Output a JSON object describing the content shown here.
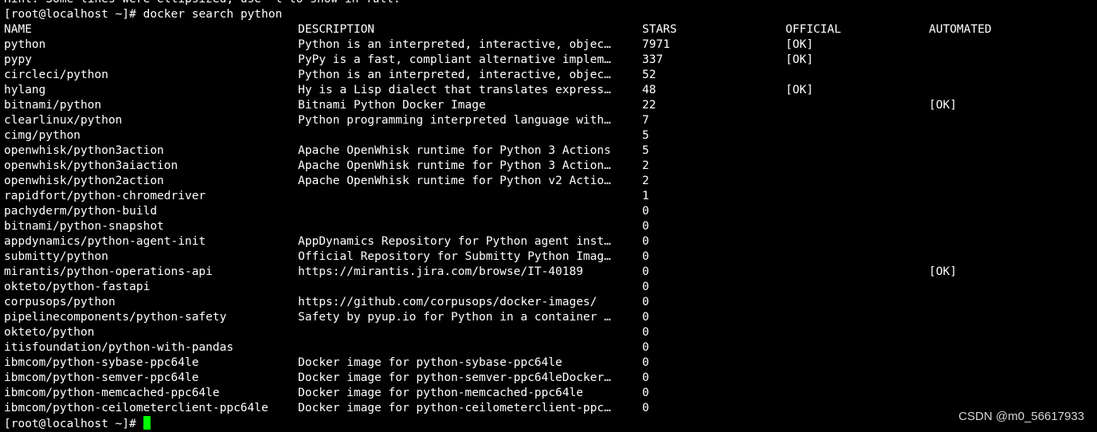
{
  "terminal": {
    "hint_text": "Hint: Some lines were ellipsized, use -l to show in full.",
    "command_prompt": "[root@localhost ~]# ",
    "command": "docker search python",
    "final_prompt": "[root@localhost ~]# ",
    "cursor_color": "#00ff00",
    "headers": {
      "name": "NAME",
      "description": "DESCRIPTION",
      "stars": "STARS",
      "official": "OFFICIAL",
      "automated": "AUTOMATED"
    },
    "rows": [
      {
        "name": "python",
        "description": "Python is an interpreted, interactive, objec…",
        "stars": "7971",
        "official": "[OK]",
        "automated": ""
      },
      {
        "name": "pypy",
        "description": "PyPy is a fast, compliant alternative implem…",
        "stars": "337",
        "official": "[OK]",
        "automated": ""
      },
      {
        "name": "circleci/python",
        "description": "Python is an interpreted, interactive, objec…",
        "stars": "52",
        "official": "",
        "automated": ""
      },
      {
        "name": "hylang",
        "description": "Hy is a Lisp dialect that translates express…",
        "stars": "48",
        "official": "[OK]",
        "automated": ""
      },
      {
        "name": "bitnami/python",
        "description": "Bitnami Python Docker Image",
        "stars": "22",
        "official": "",
        "automated": "[OK]"
      },
      {
        "name": "clearlinux/python",
        "description": "Python programming interpreted language with…",
        "stars": "7",
        "official": "",
        "automated": ""
      },
      {
        "name": "cimg/python",
        "description": "",
        "stars": "5",
        "official": "",
        "automated": ""
      },
      {
        "name": "openwhisk/python3action",
        "description": "Apache OpenWhisk runtime for Python 3 Actions",
        "stars": "5",
        "official": "",
        "automated": ""
      },
      {
        "name": "openwhisk/python3aiaction",
        "description": "Apache OpenWhisk runtime for Python 3 Action…",
        "stars": "2",
        "official": "",
        "automated": ""
      },
      {
        "name": "openwhisk/python2action",
        "description": "Apache OpenWhisk runtime for Python v2 Actio…",
        "stars": "2",
        "official": "",
        "automated": ""
      },
      {
        "name": "rapidfort/python-chromedriver",
        "description": "",
        "stars": "1",
        "official": "",
        "automated": ""
      },
      {
        "name": "pachyderm/python-build",
        "description": "",
        "stars": "0",
        "official": "",
        "automated": ""
      },
      {
        "name": "bitnami/python-snapshot",
        "description": "",
        "stars": "0",
        "official": "",
        "automated": ""
      },
      {
        "name": "appdynamics/python-agent-init",
        "description": "AppDynamics Repository for Python agent inst…",
        "stars": "0",
        "official": "",
        "automated": ""
      },
      {
        "name": "submitty/python",
        "description": "Official Repository for Submitty Python Imag…",
        "stars": "0",
        "official": "",
        "automated": ""
      },
      {
        "name": "mirantis/python-operations-api",
        "description": "https://mirantis.jira.com/browse/IT-40189",
        "stars": "0",
        "official": "",
        "automated": "[OK]"
      },
      {
        "name": "okteto/python-fastapi",
        "description": "",
        "stars": "0",
        "official": "",
        "automated": ""
      },
      {
        "name": "corpusops/python",
        "description": "https://github.com/corpusops/docker-images/",
        "stars": "0",
        "official": "",
        "automated": ""
      },
      {
        "name": "pipelinecomponents/python-safety",
        "description": "Safety by pyup.io for Python in a container …",
        "stars": "0",
        "official": "",
        "automated": ""
      },
      {
        "name": "okteto/python",
        "description": "",
        "stars": "0",
        "official": "",
        "automated": ""
      },
      {
        "name": "itisfoundation/python-with-pandas",
        "description": "",
        "stars": "0",
        "official": "",
        "automated": ""
      },
      {
        "name": "ibmcom/python-sybase-ppc64le",
        "description": "Docker image for python-sybase-ppc64le",
        "stars": "0",
        "official": "",
        "automated": ""
      },
      {
        "name": "ibmcom/python-semver-ppc64le",
        "description": "Docker image for python-semver-ppc64leDocker…",
        "stars": "0",
        "official": "",
        "automated": ""
      },
      {
        "name": "ibmcom/python-memcached-ppc64le",
        "description": "Docker image for python-memcached-ppc64le",
        "stars": "0",
        "official": "",
        "automated": ""
      },
      {
        "name": "ibmcom/python-ceilometerclient-ppc64le",
        "description": "Docker image for python-ceilometerclient-ppc…",
        "stars": "0",
        "official": "",
        "automated": ""
      }
    ]
  },
  "watermark": "CSDN @m0_56617933"
}
